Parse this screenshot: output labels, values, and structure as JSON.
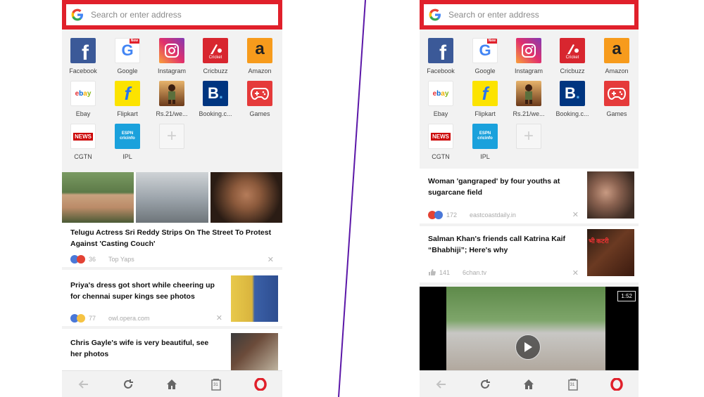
{
  "colors": {
    "divider": "#5b17a8",
    "search_border": "#e0202b",
    "opera_red": "#e0202b"
  },
  "left": {
    "search": {
      "placeholder": "Search or enter address"
    },
    "speed_dial": [
      {
        "label": "Facebook",
        "icon": "facebook-icon"
      },
      {
        "label": "Google",
        "icon": "google-icon",
        "badge": "New"
      },
      {
        "label": "Instagram",
        "icon": "instagram-icon"
      },
      {
        "label": "Cricbuzz",
        "icon": "cricbuzz-icon",
        "sub": "Cricket"
      },
      {
        "label": "Amazon",
        "icon": "amazon-icon"
      },
      {
        "label": "Ebay",
        "icon": "ebay-icon"
      },
      {
        "label": "Flipkart",
        "icon": "flipkart-icon"
      },
      {
        "label": "Rs.21/we...",
        "icon": "game-hero-icon"
      },
      {
        "label": "Booking.c...",
        "icon": "booking-icon"
      },
      {
        "label": "Games",
        "icon": "gamepad-icon"
      },
      {
        "label": "CGTN",
        "icon": "news-icon",
        "sub": "NEWS"
      },
      {
        "label": "IPL",
        "icon": "espn-cricinfo-icon",
        "sub": "ESPN cricinfo"
      },
      {
        "label": "",
        "icon": "add-icon"
      }
    ],
    "news": [
      {
        "title": "Telugu Actress Sri Reddy Strips On The Street To Protest Against 'Casting Couch'",
        "count": "36",
        "source": "Top Yaps"
      },
      {
        "title": "Priya's dress got short while cheering up for chennai super kings see photos",
        "count": "77",
        "source": "owl.opera.com"
      },
      {
        "title": "Chris Gayle's wife is very beautiful, see her photos",
        "count": "",
        "source": ""
      }
    ],
    "nav": [
      "back",
      "reload",
      "home",
      "tabs",
      "opera"
    ],
    "tabs_count": "31"
  },
  "right": {
    "search": {
      "placeholder": "Search or enter address"
    },
    "speed_dial": [
      {
        "label": "Facebook"
      },
      {
        "label": "Google",
        "badge": "New"
      },
      {
        "label": "Instagram"
      },
      {
        "label": "Cricbuzz",
        "sub": "Cricket"
      },
      {
        "label": "Amazon"
      },
      {
        "label": "Ebay"
      },
      {
        "label": "Flipkart"
      },
      {
        "label": "Rs.21/we..."
      },
      {
        "label": "Booking.c..."
      },
      {
        "label": "Games"
      },
      {
        "label": "CGTN",
        "sub": "NEWS"
      },
      {
        "label": "IPL",
        "sub": "ESPN cricinfo"
      },
      {
        "label": ""
      }
    ],
    "news": [
      {
        "title": "Woman 'gangraped' by four youths at sugarcane field",
        "count": "172",
        "source": "eastcoastdaily.in"
      },
      {
        "title": "Salman Khan's friends call Katrina Kaif “Bhabhiji”; Here's why",
        "count": "141",
        "source": "6chan.tv",
        "thumb_text": "भी कटरी"
      },
      {
        "title": "",
        "duration": "1:52"
      }
    ],
    "tabs_count": "31"
  }
}
